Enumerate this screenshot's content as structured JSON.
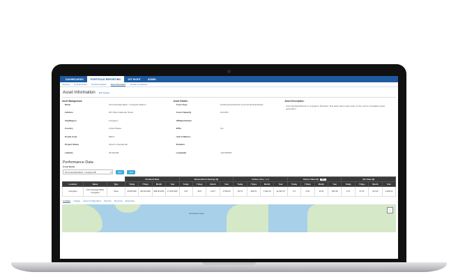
{
  "nav": {
    "items": [
      {
        "label": "DASHBOARDS",
        "active": false
      },
      {
        "label": "PORTFOLIO REPORTING",
        "active": true
      },
      {
        "label": "1ST NIGHT",
        "active": false
      },
      {
        "label": "ADMIN",
        "active": false
      }
    ]
  },
  "subnav": {
    "items": [
      {
        "label": "Explorer",
        "active": false
      },
      {
        "label": "Portfolio Admin",
        "active": false
      },
      {
        "label": "Portfolio Analysis",
        "active": false
      },
      {
        "label": "Asset Information",
        "active": true
      },
      {
        "label": "Climate Compliance",
        "active": false
      }
    ]
  },
  "asset_info": {
    "title": "Asset Information",
    "edit_label": "Edit Details",
    "background_heading": "Asset Background:",
    "details_heading": "Asset Details:",
    "description_heading": "Asset Description:",
    "background": [
      {
        "label": "Name",
        "value": "First Interstate Bank - Livingston Branch"
      },
      {
        "label": "Address",
        "value": "207 West Callender Street"
      },
      {
        "label": "City/Region",
        "value": "Livingston"
      },
      {
        "label": "Country",
        "value": "United States"
      },
      {
        "label": "Postal Code",
        "value": "59047"
      },
      {
        "label": "Project Status",
        "value": "Asset is Operational"
      },
      {
        "label": "Latitude",
        "value": "45.661448"
      }
    ],
    "details": [
      {
        "label": "Asset Type",
        "value": "Infrastructure/Climate Commercial Real Estate"
      },
      {
        "label": "Asset Capacity",
        "value": "124 kWh"
      },
      {
        "label": "Offtaker/Vendor",
        "value": ""
      },
      {
        "label": "EPAs",
        "value": "Yes"
      },
      {
        "label": "Unit of Metrics",
        "value": ""
      },
      {
        "label": "Duration",
        "value": ""
      },
      {
        "label": "Longitude",
        "value": "-110.560526"
      }
    ],
    "description": "First Interstate Branch in Livingston, Montana. This asset has a solar array on the roof for renewable power generation."
  },
  "performance": {
    "title": "Performance Data",
    "asset_label": "Asset Name",
    "asset_selected": "First Interstate Bank - Livingston Br",
    "edit_button": "Edit",
    "add_button": "Add",
    "group_headers": [
      "Produced Data",
      "Revenue/Cost Savings ($)",
      "Carbon ( lbs ) - ( t )",
      "Carbon Value ($)",
      "Net Value ($)"
    ],
    "carbon_value_input": "13",
    "columns": [
      "Location",
      "Name",
      "Type",
      "Today",
      "7 Days",
      "Month",
      "Year",
      "Today",
      "7 Days",
      "Month",
      "Year",
      "Today",
      "7 Days",
      "Month",
      "Year",
      "Today",
      "7 Days",
      "Month",
      "Year",
      "Today",
      "7 Days",
      "Month",
      "Year"
    ],
    "rows": [
      [
        "Livingston",
        "First Interstate Bank Livingston",
        "Solar",
        "29.86 kWh",
        "181.90 kWh",
        "808.00 kWh",
        "17,000 kWh",
        "4.47",
        "29.6",
        "119.7",
        "2,780.00",
        "40.79",
        "499.15",
        "1,322.20",
        "12,220.72",
        "0.3",
        "0.81",
        "11.52",
        "409.18",
        "4.47",
        "27.61",
        "131.22",
        "4,249.32"
      ]
    ]
  },
  "tabs": [
    {
      "label": "Location",
      "active": true
    },
    {
      "label": "Images",
      "active": false
    },
    {
      "label": "Asset Configuration",
      "active": false
    },
    {
      "label": "Reports",
      "active": false
    },
    {
      "label": "Revenue",
      "active": false
    },
    {
      "label": "Reporting",
      "active": false
    }
  ],
  "map": {
    "label": "North Atlantic Ocean",
    "fullscreen_icon": "fullscreen-icon"
  },
  "colors": {
    "nav_bg": "#1e5aa0",
    "button": "#3fa9d8",
    "table_header": "#3a3a3a",
    "water": "#a8d0e8"
  }
}
